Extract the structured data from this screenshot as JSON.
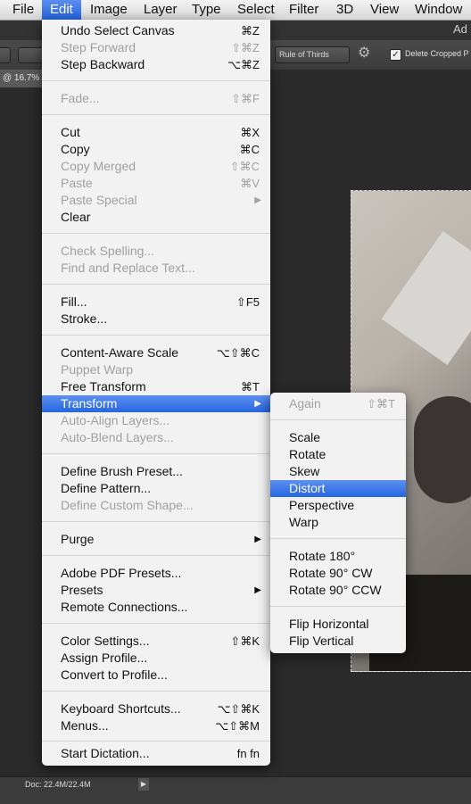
{
  "menubar": [
    "File",
    "Edit",
    "Image",
    "Layer",
    "Type",
    "Select",
    "Filter",
    "3D",
    "View",
    "Window"
  ],
  "app_title": "Ad",
  "options_bar": {
    "overlay_select": "Rule of Thirds",
    "delete_cropped_label": "Delete Cropped P"
  },
  "document_tab": "@ 16.7% (",
  "status": {
    "doc_size": "Doc: 22.4M/22.4M"
  },
  "edit_menu": {
    "undo": "Undo Select Canvas",
    "undo_sc": "⌘Z",
    "step_forward": "Step Forward",
    "step_forward_sc": "⇧⌘Z",
    "step_backward": "Step Backward",
    "step_backward_sc": "⌥⌘Z",
    "fade": "Fade...",
    "fade_sc": "⇧⌘F",
    "cut": "Cut",
    "cut_sc": "⌘X",
    "copy": "Copy",
    "copy_sc": "⌘C",
    "copy_merged": "Copy Merged",
    "copy_merged_sc": "⇧⌘C",
    "paste": "Paste",
    "paste_sc": "⌘V",
    "paste_special": "Paste Special",
    "clear": "Clear",
    "check_spelling": "Check Spelling...",
    "find_replace": "Find and Replace Text...",
    "fill": "Fill...",
    "fill_sc": "⇧F5",
    "stroke": "Stroke...",
    "content_aware": "Content-Aware Scale",
    "content_aware_sc": "⌥⇧⌘C",
    "puppet_warp": "Puppet Warp",
    "free_transform": "Free Transform",
    "free_transform_sc": "⌘T",
    "transform": "Transform",
    "auto_align": "Auto-Align Layers...",
    "auto_blend": "Auto-Blend Layers...",
    "define_brush": "Define Brush Preset...",
    "define_pattern": "Define Pattern...",
    "define_shape": "Define Custom Shape...",
    "purge": "Purge",
    "pdf_presets": "Adobe PDF Presets...",
    "presets": "Presets",
    "remote": "Remote Connections...",
    "color_settings": "Color Settings...",
    "color_settings_sc": "⇧⌘K",
    "assign_profile": "Assign Profile...",
    "convert_profile": "Convert to Profile...",
    "keyboard_shortcuts": "Keyboard Shortcuts...",
    "keyboard_shortcuts_sc": "⌥⇧⌘K",
    "menus": "Menus...",
    "menus_sc": "⌥⇧⌘M",
    "dictation": "Start Dictation...",
    "dictation_sc": "fn fn"
  },
  "transform_menu": {
    "again": "Again",
    "again_sc": "⇧⌘T",
    "scale": "Scale",
    "rotate": "Rotate",
    "skew": "Skew",
    "distort": "Distort",
    "perspective": "Perspective",
    "warp": "Warp",
    "rotate180": "Rotate 180°",
    "rotate90cw": "Rotate 90° CW",
    "rotate90ccw": "Rotate 90° CCW",
    "flip_h": "Flip Horizontal",
    "flip_v": "Flip Vertical"
  }
}
